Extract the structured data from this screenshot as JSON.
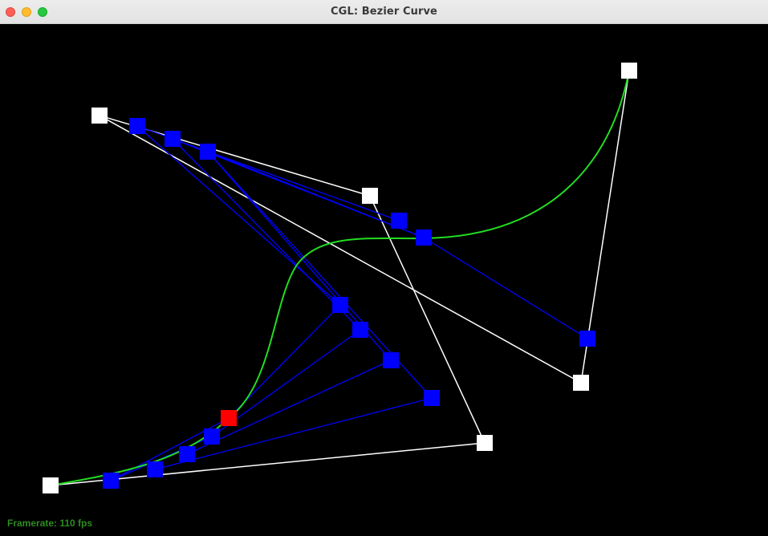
{
  "window": {
    "title": "CGL: Bezier Curve"
  },
  "status": {
    "framerate_text": "Framerate: 110 fps"
  },
  "colors": {
    "background": "#000000",
    "control_polygon": "#ffffff",
    "intermediate_lines": "#0000ff",
    "intermediate_points": "#0000ff",
    "curve": "#22dd22",
    "evaluated_point": "#ff0000",
    "close_button": "#ff5f57",
    "minimize_button": "#febc2e",
    "zoom_button": "#28c840",
    "framerate_text": "#2e8b22"
  },
  "icons": {
    "close": "close-button-dot",
    "minimize": "minimize-button-dot",
    "zoom": "zoom-button-dot"
  }
}
